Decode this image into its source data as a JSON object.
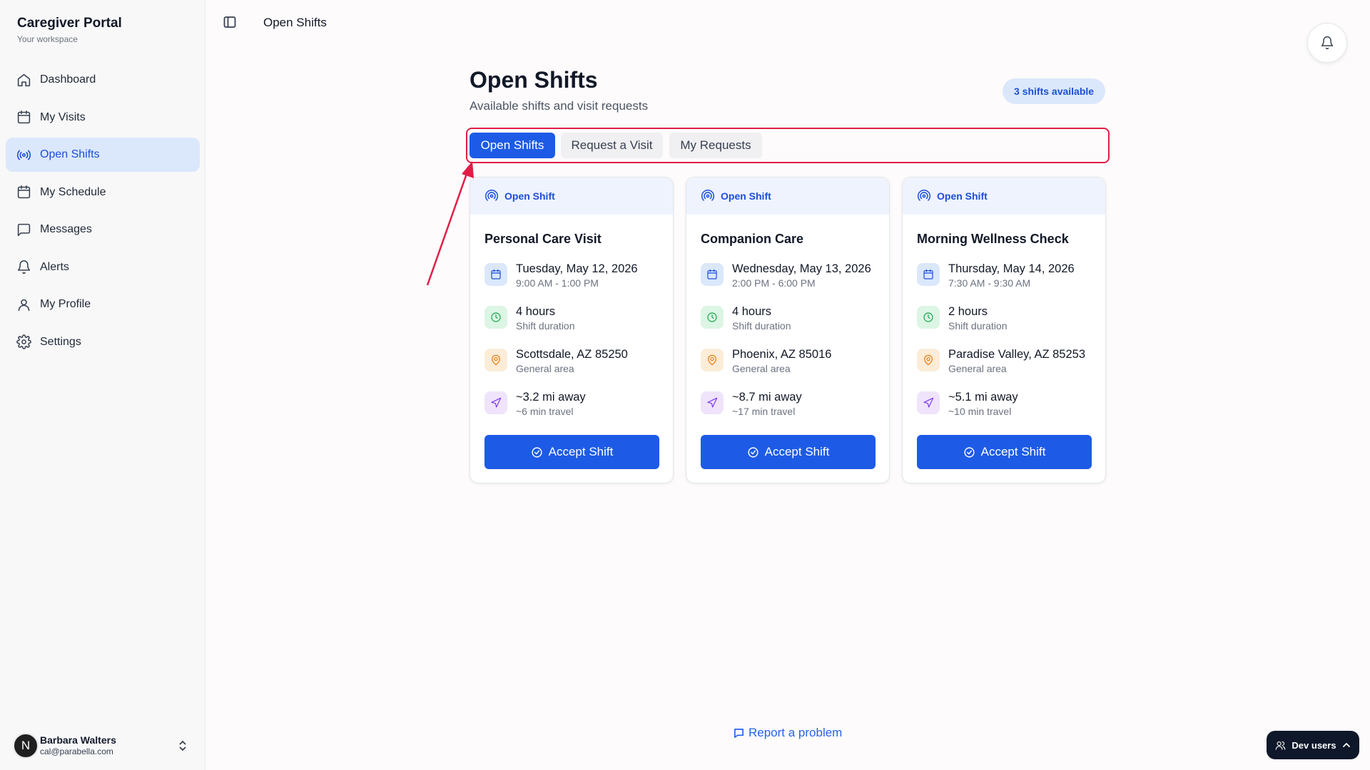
{
  "app": {
    "title": "Caregiver Portal",
    "subtitle": "Your workspace"
  },
  "sidebar": {
    "items": [
      {
        "label": "Dashboard",
        "icon": "home-icon",
        "active": false
      },
      {
        "label": "My Visits",
        "icon": "calendar-icon",
        "active": false
      },
      {
        "label": "Open Shifts",
        "icon": "radio-icon",
        "active": true
      },
      {
        "label": "My Schedule",
        "icon": "calendar-icon",
        "active": false
      },
      {
        "label": "Messages",
        "icon": "message-icon",
        "active": false
      },
      {
        "label": "Alerts",
        "icon": "bell-icon",
        "active": false
      },
      {
        "label": "My Profile",
        "icon": "user-icon",
        "active": false
      },
      {
        "label": "Settings",
        "icon": "gear-icon",
        "active": false
      }
    ]
  },
  "user": {
    "initial": "N",
    "name": "Barbara Walters",
    "email": "cal@parabella.com"
  },
  "topbar": {
    "title": "Open Shifts"
  },
  "page": {
    "title": "Open Shifts",
    "subtitle": "Available shifts and visit requests",
    "badge": "3 shifts available"
  },
  "tabs": [
    {
      "label": "Open Shifts",
      "active": true
    },
    {
      "label": "Request a Visit",
      "active": false
    },
    {
      "label": "My Requests",
      "active": false
    }
  ],
  "cards": [
    {
      "tag": "Open Shift",
      "title": "Personal Care Visit",
      "date": "Tuesday, May 12, 2026",
      "time": "9:00 AM - 1:00 PM",
      "duration": "4 hours",
      "duration_label": "Shift duration",
      "location": "Scottsdale, AZ 85250",
      "location_label": "General area",
      "distance": "~3.2 mi away",
      "travel": "~6 min travel",
      "button": "Accept Shift"
    },
    {
      "tag": "Open Shift",
      "title": "Companion Care",
      "date": "Wednesday, May 13, 2026",
      "time": "2:00 PM - 6:00 PM",
      "duration": "4 hours",
      "duration_label": "Shift duration",
      "location": "Phoenix, AZ 85016",
      "location_label": "General area",
      "distance": "~8.7 mi away",
      "travel": "~17 min travel",
      "button": "Accept Shift"
    },
    {
      "tag": "Open Shift",
      "title": "Morning Wellness Check",
      "date": "Thursday, May 14, 2026",
      "time": "7:30 AM - 9:30 AM",
      "duration": "2 hours",
      "duration_label": "Shift duration",
      "location": "Paradise Valley, AZ 85253",
      "location_label": "General area",
      "distance": "~5.1 mi away",
      "travel": "~10 min travel",
      "button": "Accept Shift"
    }
  ],
  "footer": {
    "report": "Report a problem",
    "dev_users": "Dev users"
  },
  "colors": {
    "accent": "#1d5be6",
    "highlight": "#e11d48",
    "active_nav_bg": "#dbe8fb"
  }
}
